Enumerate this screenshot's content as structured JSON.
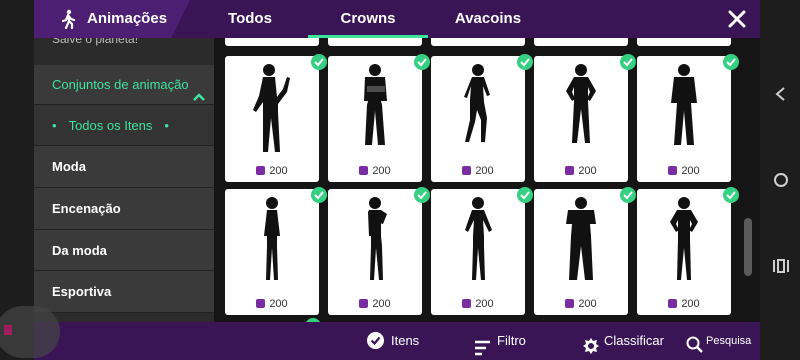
{
  "header": {
    "title": "Animações",
    "tabs": [
      {
        "label": "Todos",
        "active": false
      },
      {
        "label": "Crowns",
        "active": true
      },
      {
        "label": "Avacoins",
        "active": false
      }
    ],
    "close_icon": "close-icon",
    "accent_color": "#3fe3a0",
    "bar_color": "#3a1556"
  },
  "sidebar": {
    "top_partial": "Salve o planeta!",
    "expanded_section": "Conjuntos de animação",
    "selected_sub": "Todos os Itens",
    "items": [
      "Moda",
      "Encenação",
      "Da moda",
      "Esportiva"
    ]
  },
  "grid": {
    "rows": [
      [
        {
          "price": "200",
          "owned": true,
          "pose": "waving"
        },
        {
          "price": "200",
          "owned": true,
          "pose": "baggy-arms-crossed"
        },
        {
          "price": "200",
          "owned": true,
          "pose": "dance"
        },
        {
          "price": "200",
          "owned": true,
          "pose": "hands-on-hips"
        },
        {
          "price": "200",
          "owned": true,
          "pose": "arms-crossed"
        }
      ],
      [
        {
          "price": "200",
          "owned": true,
          "pose": "standing"
        },
        {
          "price": "200",
          "owned": true,
          "pose": "hand-to-head"
        },
        {
          "price": "200",
          "owned": true,
          "pose": "arms-out"
        },
        {
          "price": "200",
          "owned": true,
          "pose": "arms-crossed-wide"
        },
        {
          "price": "200",
          "owned": true,
          "pose": "hands-on-hips-shorts"
        }
      ]
    ],
    "currency_icon": "crown-coin-icon"
  },
  "bottom_bar": {
    "items_label": "Itens",
    "filter_label": "Filtro",
    "sort_label": "Classificar",
    "search_label": "Pesquisa"
  },
  "system_nav": [
    "back-icon",
    "home-icon",
    "recents-icon"
  ]
}
